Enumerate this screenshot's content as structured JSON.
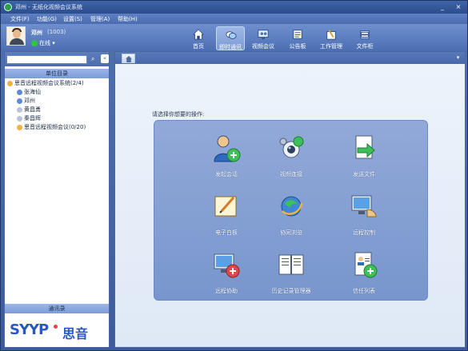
{
  "window": {
    "title": "邓州 - 无纸化视频会议系统",
    "controls": {
      "minimize": "_",
      "close": "×"
    }
  },
  "menu": {
    "items": [
      "文件(F)",
      "功能(G)",
      "设置(S)",
      "管理(A)",
      "帮助(H)"
    ]
  },
  "user": {
    "name": "邓州",
    "id": "(1003)",
    "status": "在线"
  },
  "nav": [
    {
      "label": "首页",
      "icon": "home-icon"
    },
    {
      "label": "即时通讯",
      "icon": "chat-icon"
    },
    {
      "label": "视频会议",
      "icon": "video-conference-icon"
    },
    {
      "label": "公告板",
      "icon": "board-icon"
    },
    {
      "label": "工作管理",
      "icon": "work-icon"
    },
    {
      "label": "文件柜",
      "icon": "cabinet-icon"
    }
  ],
  "sidebar": {
    "search_placeholder": "",
    "section_title": "单位目录",
    "tree": [
      {
        "label": "思音远程视频会议系统(2/4)"
      },
      {
        "label": "张海仙"
      },
      {
        "label": "邓州"
      },
      {
        "label": "黄昌勇"
      },
      {
        "label": "秦昌辉"
      },
      {
        "label": "思音远程视频会议(0/20)"
      }
    ],
    "contacts_title": "通讯录"
  },
  "logo": {
    "text": "SYYP",
    "cn": "思音"
  },
  "main": {
    "prompt": "请选择你想要的操作:",
    "actions": [
      {
        "label": "发起会话",
        "icon": "start-session-icon"
      },
      {
        "label": "视频连接",
        "icon": "video-connect-icon"
      },
      {
        "label": "发送文件",
        "icon": "send-file-icon"
      },
      {
        "label": "电子白板",
        "icon": "whiteboard-icon"
      },
      {
        "label": "协同浏览",
        "icon": "browser-icon"
      },
      {
        "label": "远程控制",
        "icon": "remote-control-icon"
      },
      {
        "label": "远程协助",
        "icon": "remote-assist-icon"
      },
      {
        "label": "历史记录管理器",
        "icon": "history-icon"
      },
      {
        "label": "信任列表",
        "icon": "trust-list-icon"
      }
    ]
  }
}
